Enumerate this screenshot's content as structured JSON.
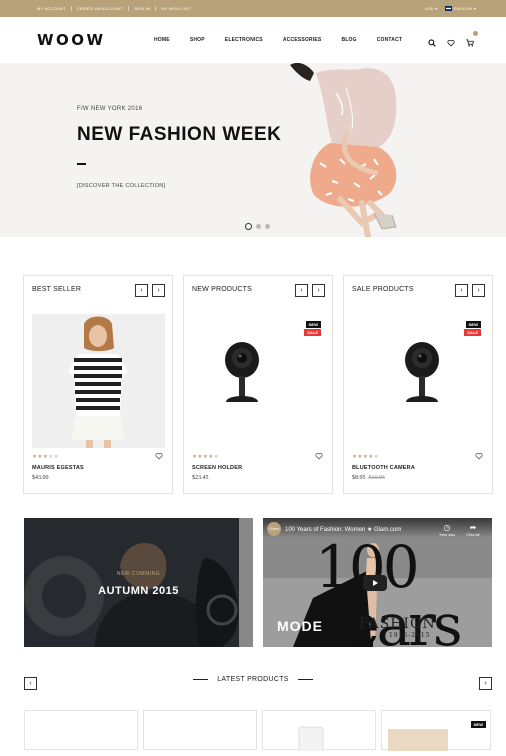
{
  "topbar": {
    "links": [
      "MY ACCOUNT",
      "CREATE AN ACCOUNT",
      "SIGN IN",
      "MY WISH LIST"
    ],
    "currency": "USD",
    "language": "ENGLISH"
  },
  "header": {
    "logo": "WOOW",
    "nav": [
      "HOME",
      "SHOP",
      "ELECTRONICS",
      "ACCESSORIES",
      "BLOG",
      "CONTACT"
    ]
  },
  "hero": {
    "subtitle": "F/W NEW YORK 2016",
    "title": "NEW FASHION WEEK",
    "cta": "[DISCOVER THE COLLECTION]",
    "slides": 3,
    "active_slide": 1
  },
  "columns": [
    {
      "heading": "BEST SELLER",
      "product": {
        "name": "MAURIS EGESTAS",
        "price": "$43.00",
        "old_price": "",
        "rating": 3,
        "new": false,
        "sale": false
      }
    },
    {
      "heading": "NEW PRODUCTS",
      "product": {
        "name": "SCREEN HOLDER",
        "price": "$23.45",
        "old_price": "",
        "rating": 4,
        "new": true,
        "sale": true
      }
    },
    {
      "heading": "SALE PRODUCTS",
      "product": {
        "name": "BLUETOOTH CAMERA",
        "price": "$8.95",
        "old_price": "$10.95",
        "rating": 4,
        "new": true,
        "sale": true
      }
    }
  ],
  "badges": {
    "new": "NEW",
    "sale": "SALE"
  },
  "promo": {
    "kicker": "NEW COMMING",
    "title": "AUTUMN 2015"
  },
  "video": {
    "title": "100 Years of Fashion: Women ★ Glam.com",
    "watch_later": "Xem sau",
    "share": "Chia sẻ",
    "channel": "Glam",
    "mode_text": "MODE",
    "big_text": "100 Years",
    "fashion_text": "FASHION",
    "years_text": "1915-2015"
  },
  "latest": {
    "heading": "LATEST PRODUCTS",
    "new_badge": "NEW"
  },
  "colors": {
    "accent": "#b7a27a",
    "sale": "#e63a3a",
    "star": "#c9a467"
  }
}
